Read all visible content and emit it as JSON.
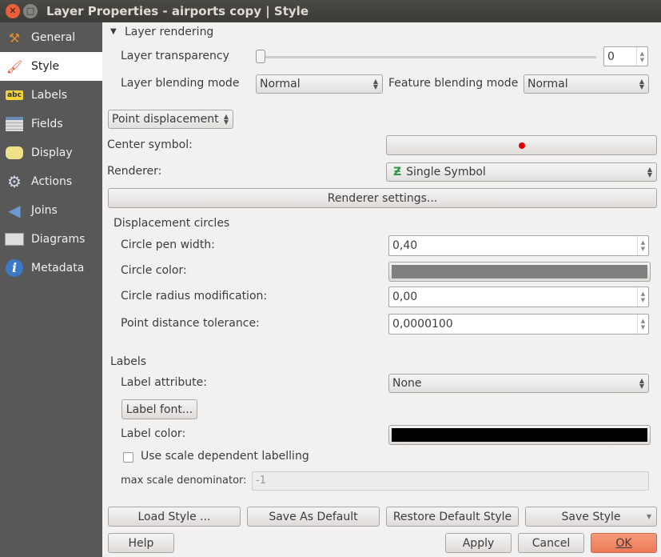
{
  "window": {
    "title": "Layer Properties - airports copy | Style"
  },
  "sidebar": {
    "items": [
      {
        "label": "General",
        "icon": "tools-icon"
      },
      {
        "label": "Style",
        "icon": "paintbrush-icon",
        "selected": true
      },
      {
        "label": "Labels",
        "icon": "abc-label-icon"
      },
      {
        "label": "Fields",
        "icon": "table-icon"
      },
      {
        "label": "Display",
        "icon": "speech-bubble-icon"
      },
      {
        "label": "Actions",
        "icon": "gear-play-icon"
      },
      {
        "label": "Joins",
        "icon": "join-icon"
      },
      {
        "label": "Diagrams",
        "icon": "diagram-icon"
      },
      {
        "label": "Metadata",
        "icon": "info-icon"
      }
    ]
  },
  "layer_rendering": {
    "title": "Layer rendering",
    "transparency_label": "Layer transparency",
    "transparency_value": "0",
    "blending_label": "Layer blending mode",
    "blending_value": "Normal",
    "feature_blending_label": "Feature blending mode",
    "feature_blending_value": "Normal"
  },
  "renderer_type": "Point displacement",
  "center_symbol": {
    "label": "Center symbol:",
    "color": "#e00000"
  },
  "renderer": {
    "label": "Renderer:",
    "value": "Single Symbol",
    "settings_button": "Renderer settings..."
  },
  "displacement": {
    "title": "Displacement circles",
    "pen_width_label": "Circle pen width:",
    "pen_width_value": "0,40",
    "color_label": "Circle color:",
    "color": "#808080",
    "radius_label": "Circle radius modification:",
    "radius_value": "0,00",
    "tolerance_label": "Point distance tolerance:",
    "tolerance_value": "0,0000100"
  },
  "labels": {
    "title": "Labels",
    "attribute_label": "Label attribute:",
    "attribute_value": "None",
    "font_button": "Label font...",
    "color_label": "Label color:",
    "color": "#000000",
    "scale_checkbox": "Use scale dependent labelling",
    "scale_checked": false,
    "max_scale_label": "max scale denominator:",
    "max_scale_value": "-1"
  },
  "buttons": {
    "load_style": "Load Style ...",
    "save_default": "Save As Default",
    "restore_default": "Restore Default Style",
    "save_style": "Save Style",
    "help": "Help",
    "apply": "Apply",
    "cancel": "Cancel",
    "ok": "OK"
  }
}
